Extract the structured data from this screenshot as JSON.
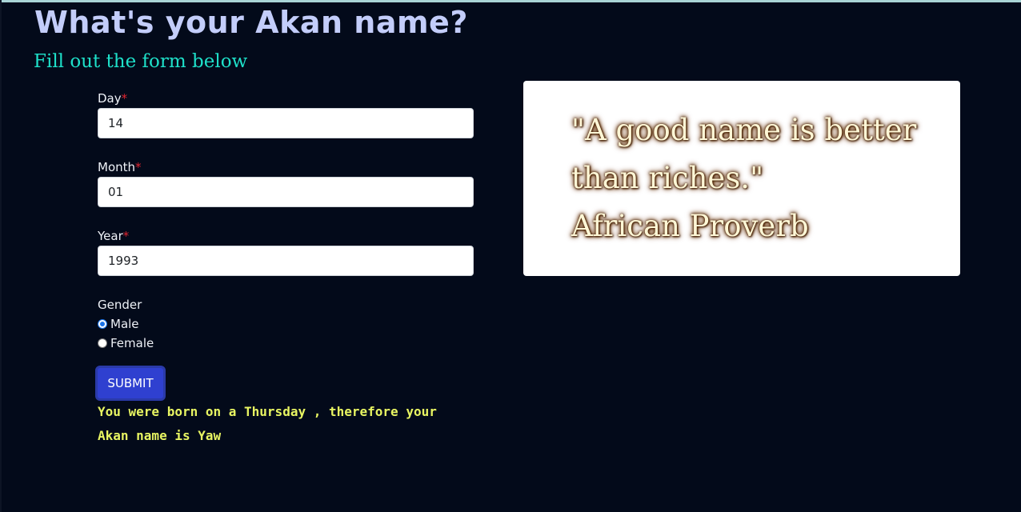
{
  "header": {
    "title": "What's your Akan name?",
    "subtitle": "Fill out the form below"
  },
  "form": {
    "day": {
      "label": "Day",
      "required_mark": "*",
      "value": "14"
    },
    "month": {
      "label": "Month",
      "required_mark": "*",
      "value": "01"
    },
    "year": {
      "label": "Year",
      "required_mark": "*",
      "value": "1993"
    },
    "gender": {
      "label": "Gender",
      "options": [
        {
          "label": "Male",
          "checked": true
        },
        {
          "label": "Female",
          "checked": false
        }
      ]
    },
    "submit_label": "SUBMIT"
  },
  "result": {
    "line1": "You were born on a Thursday , therefore your",
    "line2": "Akan name is Yaw"
  },
  "quote": {
    "line1": "\"A good name is better",
    "line2": "than riches.\"",
    "line3": "African Proverb"
  },
  "colors": {
    "background": "#030a1a",
    "title": "#c3cdfa",
    "subtitle": "#1ee0c9",
    "result": "#e8f562",
    "button": "#2f40d0",
    "required": "#e0242f"
  }
}
